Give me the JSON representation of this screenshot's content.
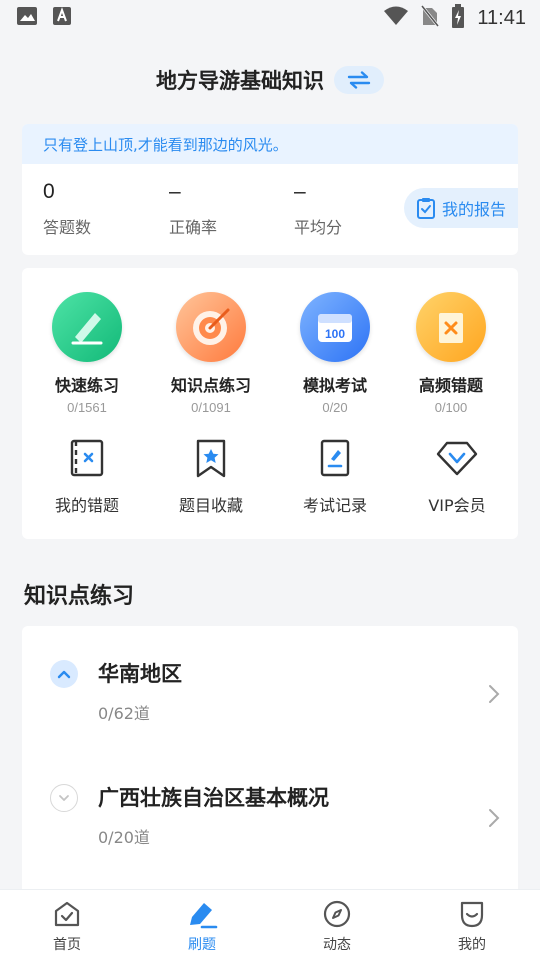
{
  "status_bar": {
    "time": "11:41"
  },
  "header": {
    "title": "地方导游基础知识"
  },
  "motto": "只有登上山顶,才能看到那边的风光。",
  "stats": [
    {
      "value": "0",
      "label": "答题数"
    },
    {
      "value": "–",
      "label": "正确率"
    },
    {
      "value": "–",
      "label": "平均分"
    }
  ],
  "report_button": "我的报告",
  "features": [
    {
      "title": "快速练习",
      "count": "0/1561"
    },
    {
      "title": "知识点练习",
      "count": "0/1091"
    },
    {
      "title": "模拟考试",
      "count": "0/20"
    },
    {
      "title": "高频错题",
      "count": "0/100"
    }
  ],
  "tools": [
    {
      "label": "我的错题"
    },
    {
      "label": "题目收藏"
    },
    {
      "label": "考试记录"
    },
    {
      "label": "VIP会员"
    }
  ],
  "section_title": "知识点练习",
  "knowledge_list": [
    {
      "title": "华南地区",
      "sub": "0/62道",
      "expanded": true
    },
    {
      "title": "广西壮族自治区基本概况",
      "sub": "0/20道",
      "expanded": false
    }
  ],
  "bottom_nav": [
    {
      "label": "首页",
      "icon": "home-icon"
    },
    {
      "label": "刷题",
      "icon": "pen-icon",
      "active": true
    },
    {
      "label": "动态",
      "icon": "compass-icon"
    },
    {
      "label": "我的",
      "icon": "profile-icon"
    }
  ],
  "colors": {
    "accent": "#2a8bf0",
    "background": "#f4f5f7"
  }
}
